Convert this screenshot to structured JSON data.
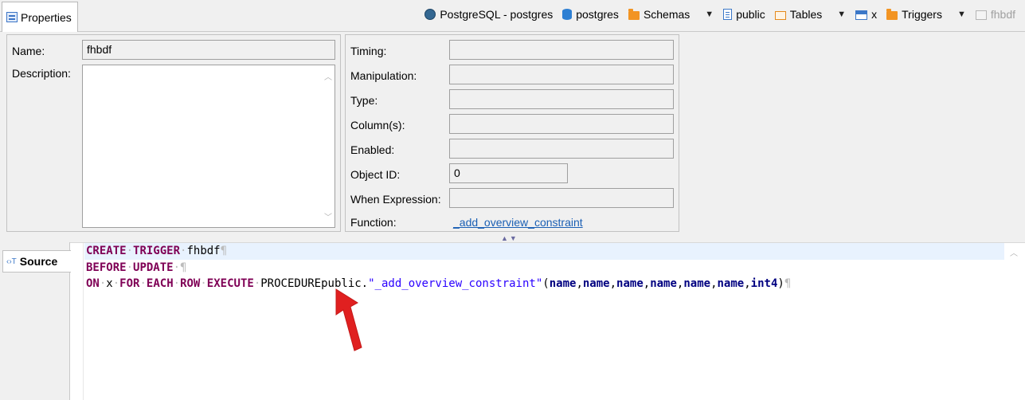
{
  "tabs": {
    "properties": "Properties",
    "source": "Source"
  },
  "breadcrumbs": [
    {
      "label": "PostgreSQL - postgres",
      "icon": "postgres-icon"
    },
    {
      "label": "postgres",
      "icon": "database-icon"
    },
    {
      "label": "Schemas",
      "icon": "folder-icon"
    },
    {
      "label": "public",
      "icon": "schema-icon"
    },
    {
      "label": "Tables",
      "icon": "tables-folder-icon"
    },
    {
      "label": "x",
      "icon": "table-icon"
    },
    {
      "label": "Triggers",
      "icon": "folder-icon"
    },
    {
      "label": "fhbdf",
      "icon": "trigger-icon"
    }
  ],
  "left_panel": {
    "name_label": "Name:",
    "name_value": "fhbdf",
    "description_label": "Description:",
    "description_value": ""
  },
  "right_panel": {
    "timing_label": "Timing:",
    "timing_value": "",
    "manipulation_label": "Manipulation:",
    "manipulation_value": "",
    "type_label": "Type:",
    "type_value": "",
    "columns_label": "Column(s):",
    "columns_value": "",
    "enabled_label": "Enabled:",
    "enabled_value": "",
    "object_id_label": "Object ID:",
    "object_id_value": "0",
    "when_expression_label": "When Expression:",
    "when_expression_value": "",
    "function_label": "Function:",
    "function_link": "_add_overview_constraint"
  },
  "source_code": {
    "line1": {
      "kw1": "CREATE",
      "kw2": "TRIGGER",
      "name": "fhbdf"
    },
    "line2": {
      "kw1": "BEFORE",
      "kw2": "UPDATE"
    },
    "line3": {
      "on": "ON",
      "table": "x",
      "for": "FOR",
      "each": "EACH",
      "row": "ROW",
      "execute": "EXECUTE",
      "procedure": "PROCEDURE",
      "schema": "public.",
      "func": "\"_add_overview_constraint\"",
      "args": [
        "name",
        "name",
        "name",
        "name",
        "name",
        "name",
        "int4"
      ]
    }
  },
  "colors": {
    "keyword": "#7f0055",
    "type": "#000080",
    "string": "#2a00ff",
    "link": "#1a5fb4",
    "annotation_arrow": "#e02020"
  }
}
